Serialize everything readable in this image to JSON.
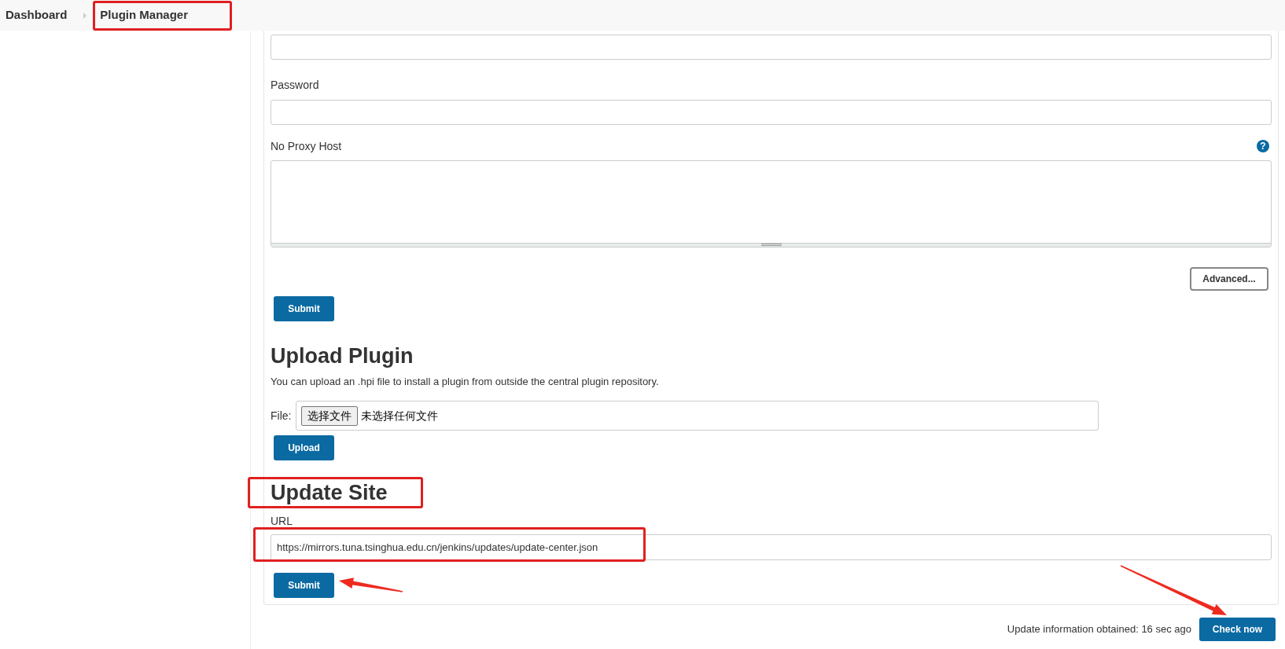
{
  "breadcrumbs": [
    {
      "label": "Dashboard",
      "highlighted": false
    },
    {
      "label": "Plugin Manager",
      "highlighted": true
    }
  ],
  "proxy": {
    "fields": [
      {
        "kind": "text"
      },
      {
        "kind": "text",
        "label": "Password"
      },
      {
        "kind": "textarea",
        "label": "No Proxy Host",
        "help_icon": "?"
      }
    ],
    "advanced_button": "Advanced...",
    "submit_button": {
      "label": "Submit",
      "pointed_at": false
    }
  },
  "upload_plugin": {
    "title": "Upload Plugin",
    "description": "You can upload an .hpi file to install a plugin from outside the central plugin repository.",
    "file_label": "File:",
    "choose_button": "选择文件",
    "file_status": "未选择任何文件",
    "upload_button": "Upload"
  },
  "update_site": {
    "title": "Update Site",
    "highlighted": true,
    "url_label": "URL",
    "url": {
      "value": "https://mirrors.tuna.tsinghua.edu.cn/jenkins/updates/update-center.json",
      "highlighted": true
    },
    "submit_button": {
      "label": "Submit",
      "pointed_at": true
    }
  },
  "footer": {
    "status": "Update information obtained: 16 sec ago",
    "check_button": {
      "label": "Check now",
      "pointed_at": true
    }
  }
}
